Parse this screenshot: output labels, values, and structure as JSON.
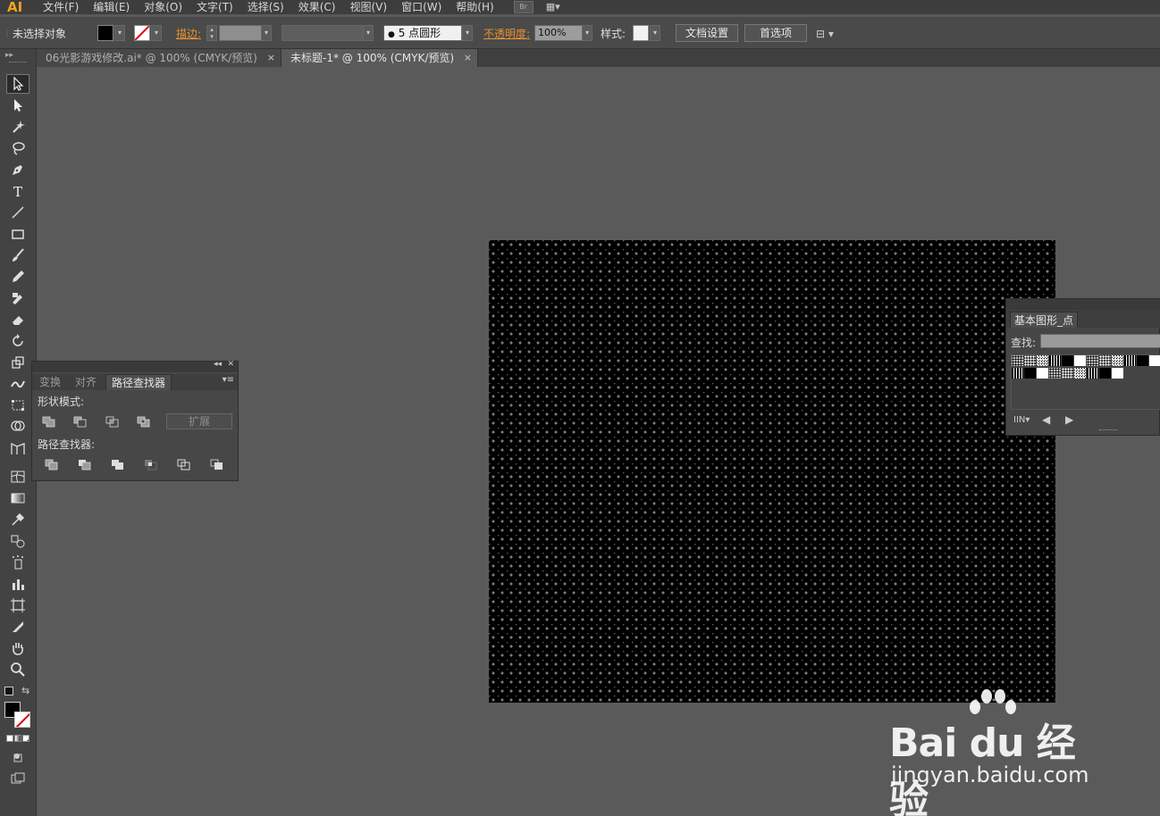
{
  "app": {
    "logo": "AI"
  },
  "menu": [
    "文件(F)",
    "编辑(E)",
    "对象(O)",
    "文字(T)",
    "选择(S)",
    "效果(C)",
    "视图(V)",
    "窗口(W)",
    "帮助(H)"
  ],
  "menu_extra": {
    "bridge": "Br",
    "arrange": "▦▾"
  },
  "control": {
    "selection": "未选择对象",
    "stroke_label": "描边:",
    "brush": "5 点圆形",
    "opacity_label": "不透明度:",
    "opacity_value": "100%",
    "style_label": "样式:",
    "doc_setup": "文档设置",
    "preferences": "首选项"
  },
  "tabs": [
    {
      "label": "06光影游戏修改.ai* @ 100% (CMYK/预览)",
      "close": "×"
    },
    {
      "label": "未标题-1* @ 100% (CMYK/预览)",
      "close": "×"
    }
  ],
  "pathfinder": {
    "tabs": [
      "变换",
      "对齐",
      "路径查找器"
    ],
    "shape_modes": "形状模式:",
    "expand": "扩展",
    "pathfinders": "路径查找器:",
    "menu_icon": "▾≡",
    "collapse": "◂◂",
    "close": "✕"
  },
  "symbols": {
    "tab": "基本图形_点",
    "search_label": "查找:",
    "footer_icon": "IIN▾"
  },
  "watermark": {
    "brand": "Bai du 经验",
    "url": "jingyan.baidu.com"
  },
  "colors": {
    "accent": "#e8912c",
    "bg": "#5a5a5a",
    "panel": "#474747"
  }
}
